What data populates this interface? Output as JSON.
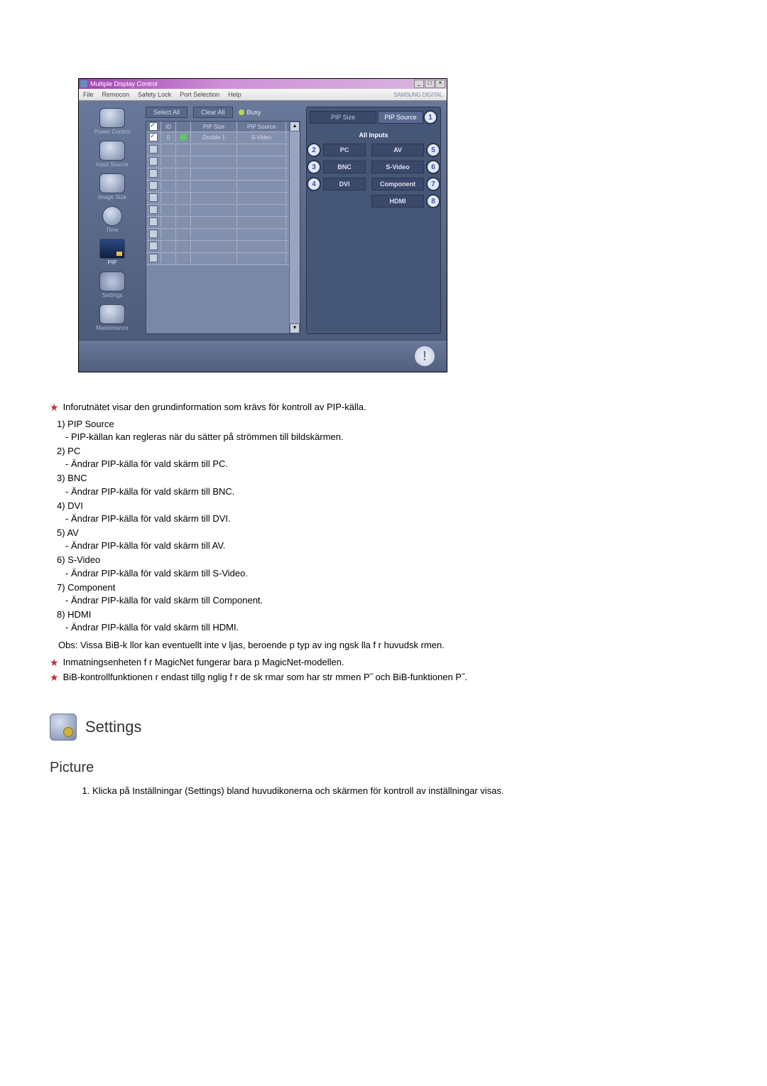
{
  "app": {
    "title": "Multiple Display Control",
    "brand": "SAMSUNG DIGITAL",
    "menus": [
      "File",
      "Remocon",
      "Safety Lock",
      "Port Selection",
      "Help"
    ]
  },
  "toolbar": {
    "select_all": "Select All",
    "clear_all": "Clear All",
    "busy": "Busy"
  },
  "sidebar": {
    "items": [
      {
        "label": "Power Control"
      },
      {
        "label": "Input Source"
      },
      {
        "label": "Image Size"
      },
      {
        "label": "Time"
      },
      {
        "label": "PIP"
      },
      {
        "label": "Settings"
      },
      {
        "label": "Maintenance"
      }
    ]
  },
  "grid": {
    "headers": {
      "id": "ID",
      "pip_size": "PIP Size",
      "pip_source": "PIP Source"
    },
    "rows": [
      {
        "checked": true,
        "id": "0",
        "status": "on",
        "pip_size": "Double 1",
        "pip_source": "S-Video"
      }
    ],
    "blank_rows": 10
  },
  "rightpanel": {
    "tabs": {
      "pip_size": "PIP Size",
      "pip_source": "PIP Source"
    },
    "tab_callout": "1",
    "all_inputs": "All Inputs",
    "left_col": [
      {
        "num": "2",
        "label": "PC"
      },
      {
        "num": "3",
        "label": "BNC"
      },
      {
        "num": "4",
        "label": "DVI"
      }
    ],
    "right_col": [
      {
        "num": "5",
        "label": "AV"
      },
      {
        "num": "6",
        "label": "S-Video"
      },
      {
        "num": "7",
        "label": "Component"
      },
      {
        "num": "8",
        "label": "HDMI"
      }
    ]
  },
  "doc": {
    "intro": "Inforutnätet visar den grundinformation som krävs för kontroll av PIP-källa.",
    "items": [
      {
        "n": "1)",
        "label": "PIP Source",
        "desc": "- PIP-källan kan regleras när du sätter på strömmen till bildskärmen."
      },
      {
        "n": "2)",
        "label": "PC",
        "desc": "- Ändrar PIP-källa för vald skärm till PC."
      },
      {
        "n": "3)",
        "label": "BNC",
        "desc": "- Ändrar PIP-källa för vald skärm till BNC."
      },
      {
        "n": "4)",
        "label": "DVI",
        "desc": "- Ändrar PIP-källa för vald skärm till DVI."
      },
      {
        "n": "5)",
        "label": "AV",
        "desc": "- Ändrar PIP-källa för vald skärm till AV."
      },
      {
        "n": "6)",
        "label": "S-Video",
        "desc": "- Ändrar PIP-källa för vald skärm till S-Video."
      },
      {
        "n": "7)",
        "label": "Component",
        "desc": "- Ändrar PIP-källa för vald skärm till Component."
      },
      {
        "n": "8)",
        "label": "HDMI",
        "desc": "- Ändrar PIP-källa för vald skärm till HDMI."
      }
    ],
    "obs": "Obs: Vissa BiB-k llor kan eventuellt inte v ljas, beroende p  typ av ing ngsk lla f r huvudsk rmen.",
    "note1": "Inmatningsenheten f r MagicNet fungerar bara p  MagicNet-modellen.",
    "note2": "BiB-kontrollfunktionen  r endast tillg nglig f r de             sk rmar som har str mmen P˝ och BiB-funktionen P˝.",
    "settings_header": "Settings",
    "picture_header": "Picture",
    "picture_step1": "Klicka på Inställningar (Settings) bland huvudikonerna och skärmen för kontroll av inställningar visas."
  }
}
